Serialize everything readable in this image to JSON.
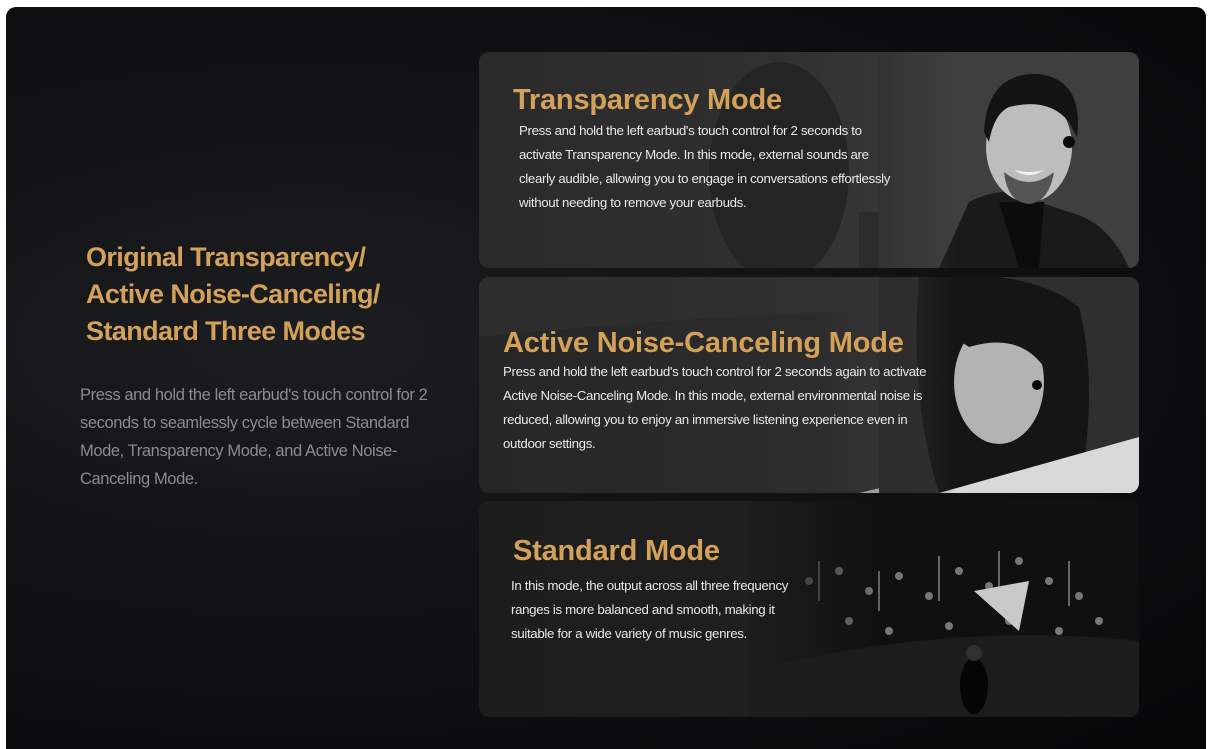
{
  "intro": {
    "title_lines": [
      "Original Transparency/",
      "Active Noise-Canceling/",
      "Standard Three Modes"
    ],
    "description": "Press and hold the left earbud's touch control for 2 seconds to seamlessly cycle between Standard Mode, Transparency Mode, and Active Noise-Canceling Mode."
  },
  "modes": [
    {
      "title": "Transparency Mode",
      "description": "Press and hold the left earbud's touch control for 2 seconds to activate Transparency Mode. In this mode, external sounds are clearly audible, allowing you to engage in conversations effortlessly without needing to remove your earbuds."
    },
    {
      "title": "Active Noise-Canceling Mode",
      "description": "Press and hold the left earbud's touch control for 2 seconds again to activate Active Noise-Canceling Mode. In this mode, external environmental noise is reduced, allowing you to enjoy an immersive listening experience even in outdoor settings."
    },
    {
      "title": "Standard Mode",
      "description": "In this mode, the output across all three frequency ranges is more balanced and smooth, making it suitable for a wide variety of music genres."
    }
  ],
  "colors": {
    "accent": "#d3a15a",
    "background": "#111214",
    "body_text": "#8b8b8b",
    "card_text": "#e8e8e8"
  }
}
